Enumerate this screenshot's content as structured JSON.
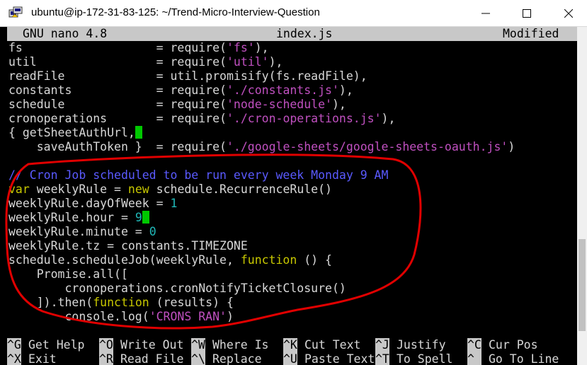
{
  "window": {
    "title": "ubuntu@ip-172-31-83-125: ~/Trend-Micro-Interview-Question",
    "minimize_glyph": "─",
    "maximize_glyph": "☐",
    "close_glyph": "✕",
    "icon": "putty-icon"
  },
  "nano": {
    "version": "GNU nano 4.8",
    "filename": "index.js",
    "status": "Modified"
  },
  "code": [
    [
      {
        "t": "fs                   ",
        "c": "id"
      },
      {
        "t": "= require(",
        "c": "op"
      },
      {
        "t": "'fs'",
        "c": "str"
      },
      {
        "t": "),",
        "c": "op"
      }
    ],
    [
      {
        "t": "util                 ",
        "c": "id"
      },
      {
        "t": "= require(",
        "c": "op"
      },
      {
        "t": "'util'",
        "c": "str"
      },
      {
        "t": "),",
        "c": "op"
      }
    ],
    [
      {
        "t": "readFile             ",
        "c": "id"
      },
      {
        "t": "= util.promisify(fs.readFile),",
        "c": "op"
      }
    ],
    [
      {
        "t": "constants            ",
        "c": "id"
      },
      {
        "t": "= require(",
        "c": "op"
      },
      {
        "t": "'./constants.js'",
        "c": "str"
      },
      {
        "t": "),",
        "c": "op"
      }
    ],
    [
      {
        "t": "schedule             ",
        "c": "id"
      },
      {
        "t": "= require(",
        "c": "op"
      },
      {
        "t": "'node-schedule'",
        "c": "str"
      },
      {
        "t": "),",
        "c": "op"
      }
    ],
    [
      {
        "t": "cronoperations       ",
        "c": "id"
      },
      {
        "t": "= require(",
        "c": "op"
      },
      {
        "t": "'./cron-operations.js'",
        "c": "str"
      },
      {
        "t": "),",
        "c": "op"
      }
    ],
    [
      {
        "t": "{ getSheetAuthUrl,",
        "c": "id"
      },
      {
        "t": "",
        "c": "cursor"
      }
    ],
    [
      {
        "t": "    saveAuthToken }  ",
        "c": "id"
      },
      {
        "t": "= require(",
        "c": "op"
      },
      {
        "t": "'./google-sheets/google-sheets-oauth.js'",
        "c": "str"
      },
      {
        "t": ")",
        "c": "op"
      }
    ],
    [],
    [
      {
        "t": "// Cron Job scheduled to be run every week Monday 9 AM",
        "c": "cmt"
      }
    ],
    [
      {
        "t": "var",
        "c": "kw"
      },
      {
        "t": " weeklyRule = ",
        "c": "id"
      },
      {
        "t": "new",
        "c": "kw"
      },
      {
        "t": " schedule.RecurrenceRule()",
        "c": "id"
      }
    ],
    [
      {
        "t": "weeklyRule.dayOfWeek = ",
        "c": "id"
      },
      {
        "t": "1",
        "c": "num"
      }
    ],
    [
      {
        "t": "weeklyRule.hour = ",
        "c": "id"
      },
      {
        "t": "9",
        "c": "num"
      },
      {
        "t": "",
        "c": "cursor"
      }
    ],
    [
      {
        "t": "weeklyRule.minute = ",
        "c": "id"
      },
      {
        "t": "0",
        "c": "num"
      }
    ],
    [
      {
        "t": "weeklyRule.tz = constants.TIMEZONE",
        "c": "id"
      }
    ],
    [
      {
        "t": "schedule.scheduleJob(weeklyRule, ",
        "c": "id"
      },
      {
        "t": "function",
        "c": "kw"
      },
      {
        "t": " () {",
        "c": "id"
      }
    ],
    [
      {
        "t": "    Promise.all([",
        "c": "id"
      }
    ],
    [
      {
        "t": "        cronoperations.cronNotifyTicketClosure()",
        "c": "id"
      }
    ],
    [
      {
        "t": "    ]).then(",
        "c": "id"
      },
      {
        "t": "function",
        "c": "kw"
      },
      {
        "t": " (results) {",
        "c": "id"
      }
    ],
    [
      {
        "t": "        console.log(",
        "c": "id"
      },
      {
        "t": "'CRONS RAN'",
        "c": "str"
      },
      {
        "t": ")",
        "c": "id"
      }
    ]
  ],
  "help": {
    "row1": [
      {
        "key": "^G",
        "label": "Get Help"
      },
      {
        "key": "^O",
        "label": "Write Out"
      },
      {
        "key": "^W",
        "label": "Where Is"
      },
      {
        "key": "^K",
        "label": "Cut Text"
      },
      {
        "key": "^J",
        "label": "Justify"
      },
      {
        "key": "^C",
        "label": "Cur Pos"
      }
    ],
    "row2": [
      {
        "key": "^X",
        "label": "Exit"
      },
      {
        "key": "^R",
        "label": "Read File"
      },
      {
        "key": "^\\",
        "label": "Replace"
      },
      {
        "key": "^U",
        "label": "Paste Text"
      },
      {
        "key": "^T",
        "label": "To Spell"
      },
      {
        "key": "^_",
        "label": "Go To Line"
      }
    ]
  },
  "colors": {
    "annotation": "#e00000",
    "cursor": "#00c800"
  }
}
